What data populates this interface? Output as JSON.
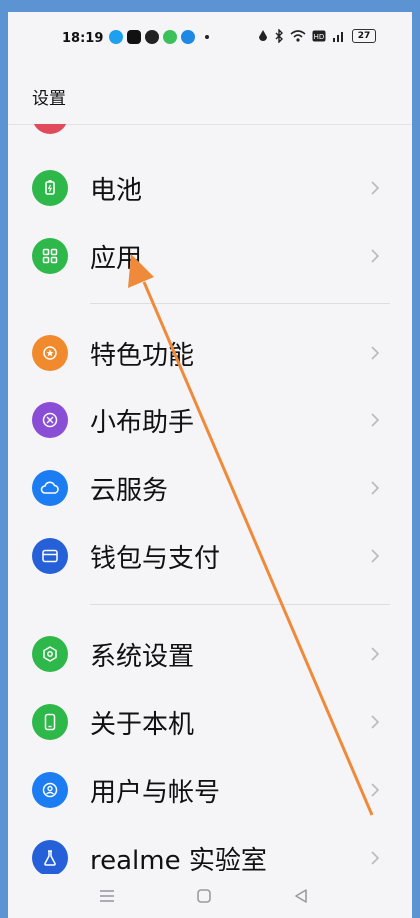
{
  "status_bar": {
    "time": "18:19",
    "battery_level": "27"
  },
  "header": {
    "title": "设置"
  },
  "items": [
    {
      "label": "电池",
      "icon": "battery-icon",
      "color": "#2fb84a"
    },
    {
      "label": "应用",
      "icon": "apps-grid-icon",
      "color": "#2fb84a"
    },
    {
      "label": "特色功能",
      "icon": "star-badge-icon",
      "color": "#f08a2c"
    },
    {
      "label": "小布助手",
      "icon": "assistant-icon",
      "color": "#8a4ed6"
    },
    {
      "label": "云服务",
      "icon": "cloud-icon",
      "color": "#1c7df2"
    },
    {
      "label": "钱包与支付",
      "icon": "wallet-icon",
      "color": "#2560d8"
    },
    {
      "label": "系统设置",
      "icon": "hexagon-gear-icon",
      "color": "#2fb84a"
    },
    {
      "label": "关于本机",
      "icon": "phone-icon",
      "color": "#2fb84a"
    },
    {
      "label": "用户与帐号",
      "icon": "user-icon",
      "color": "#1c7df2"
    },
    {
      "label": "realme 实验室",
      "icon": "flask-icon",
      "color": "#2560d8"
    }
  ],
  "colors": {
    "annotation_arrow": "#ef8a3a",
    "frame": "#5b93d3"
  }
}
